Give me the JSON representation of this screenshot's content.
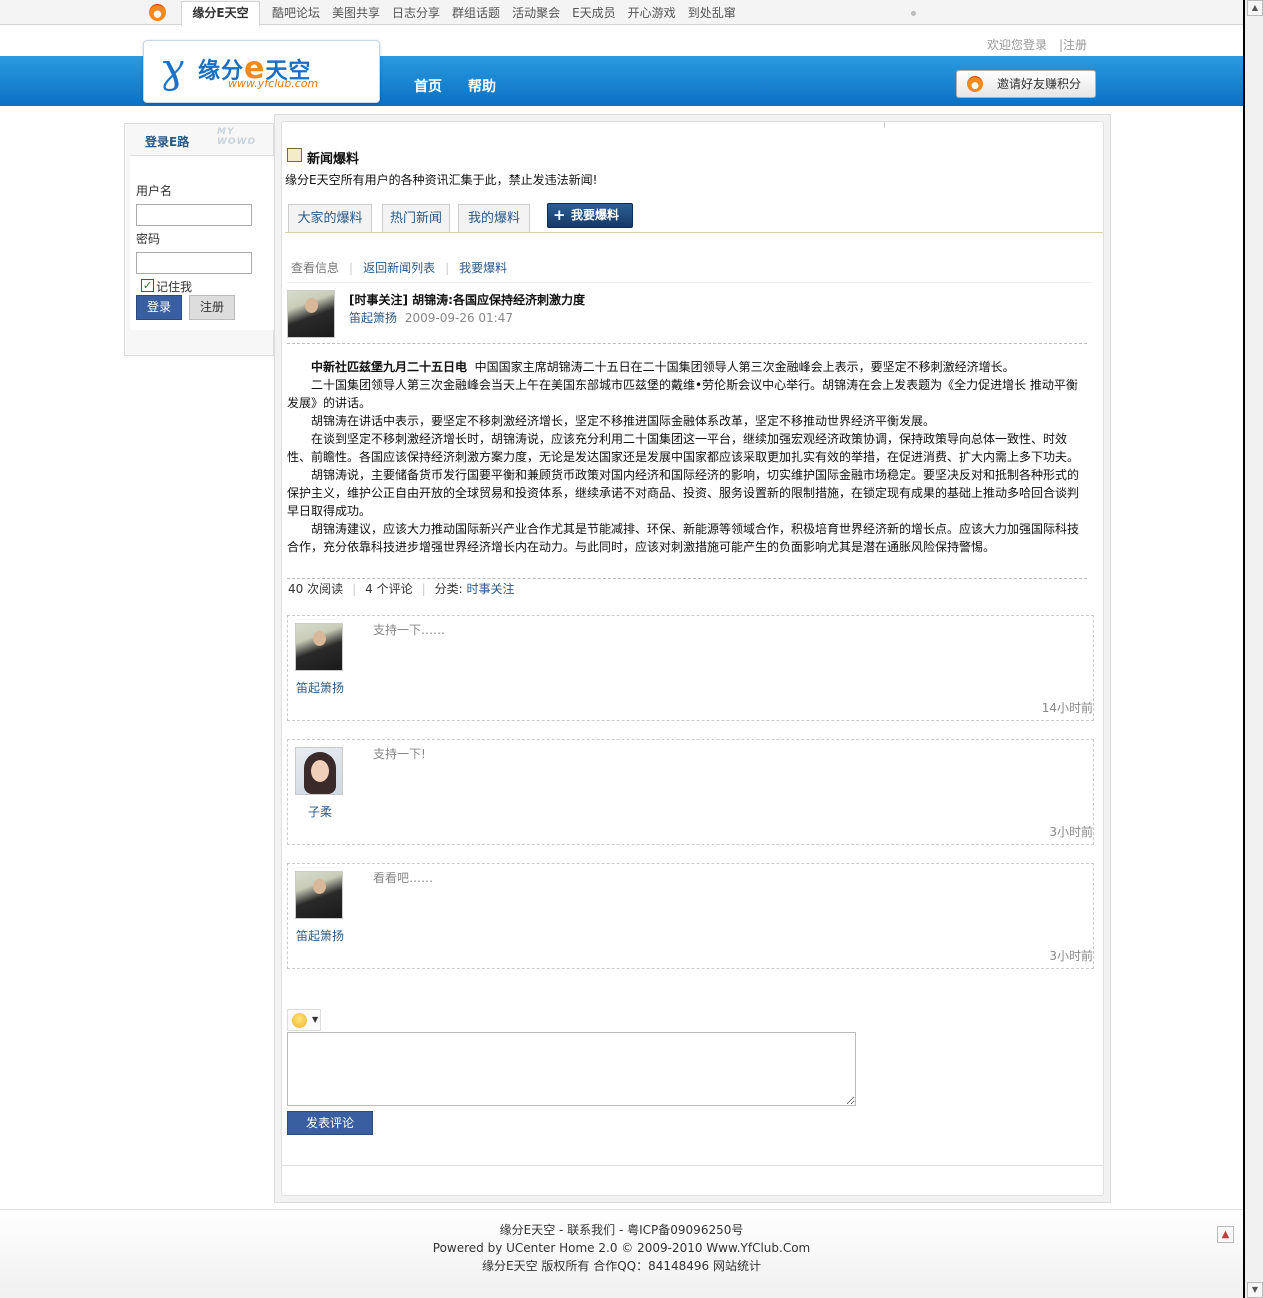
{
  "topbar": {
    "site_tab": "缘分E天空",
    "nav": [
      "酷吧论坛",
      "美图共享",
      "日志分享",
      "群组话题",
      "活动聚会",
      "E天成员",
      "开心游戏",
      "到处乱窜"
    ],
    "user_links": "欢迎您登录　|注册"
  },
  "header": {
    "logo_name": "缘分",
    "logo_e": "e",
    "logo_name2": "天空",
    "logo_url": "www.yfclub.com",
    "nav": [
      "首页",
      "帮助"
    ],
    "invite_label": "邀请好友赚积分"
  },
  "sidebar": {
    "title": "登录E路",
    "deco": "MY WOWO",
    "username_label": "用户名",
    "password_label": "密码",
    "remember_label": "记住我",
    "login_button": "登录",
    "register_button": "注册"
  },
  "page": {
    "title": "新闻爆料",
    "description": "缘分E天空所有用户的各种资讯汇集于此，禁止发违法新闻!",
    "tabs": [
      "大家的爆料",
      "热门新闻",
      "我的爆料"
    ],
    "post_button": "我要爆料",
    "subnav": [
      "查看信息",
      "返回新闻列表",
      "我要爆料"
    ]
  },
  "post": {
    "title": "[时事关注] 胡锦涛:各国应保持经济刺激力度",
    "author": "笛起箫扬",
    "date": "2009-09-26 01:47",
    "lead_bold": "中新社匹兹堡九月二十五日电",
    "paragraphs": [
      "中国国家主席胡锦涛二十五日在二十国集团领导人第三次金融峰会上表示，要坚定不移刺激经济增长。",
      "二十国集团领导人第三次金融峰会当天上午在美国东部城市匹兹堡的戴维•劳伦斯会议中心举行。胡锦涛在会上发表题为《全力促进增长 推动平衡发展》的讲话。",
      "胡锦涛在讲话中表示，要坚定不移刺激经济增长，坚定不移推进国际金融体系改革，坚定不移推动世界经济平衡发展。",
      "在谈到坚定不移刺激经济增长时，胡锦涛说，应该充分利用二十国集团这一平台，继续加强宏观经济政策协调，保持政策导向总体一致性、时效性、前瞻性。各国应该保持经济刺激方案力度，无论是发达国家还是发展中国家都应该采取更加扎实有效的举措，在促进消费、扩大内需上多下功夫。",
      "胡锦涛说，主要储备货币发行国要平衡和兼顾货币政策对国内经济和国际经济的影响，切实维护国际金融市场稳定。要坚决反对和抵制各种形式的保护主义，维护公正自由开放的全球贸易和投资体系，继续承诺不对商品、投资、服务设置新的限制措施，在锁定现有成果的基础上推动多哈回合谈判早日取得成功。",
      "胡锦涛建议，应该大力推动国际新兴产业合作尤其是节能减排、环保、新能源等领域合作，积极培育世界经济新的增长点。应该大力加强国际科技合作，充分依靠科技进步增强世界经济增长内在动力。与此同时，应该对刺激措施可能产生的负面影响尤其是潜在通胀风险保持警惕。"
    ],
    "views": "40 次阅读",
    "comments_count": "4 个评论",
    "category_label": "分类:",
    "category": "时事关注"
  },
  "comments": [
    {
      "name": "笛起箫扬",
      "text": "支持一下……",
      "time": "14小时前"
    },
    {
      "name": "子柔",
      "text": "支持一下!",
      "time": "3小时前"
    },
    {
      "name": "笛起箫扬",
      "text": "看看吧……",
      "time": "3小时前"
    }
  ],
  "comment_form": {
    "submit_button": "发表评论"
  },
  "footer": {
    "line1": "缘分E天空 - 联系我们 - 粤ICP备09096250号",
    "line2": "Powered by UCenter Home 2.0 © 2009-2010 Www.YfClub.Com",
    "line3": "缘分E天空 版权所有 合作QQ：84148496 网站统计"
  },
  "colors": {
    "header_blue": "#0b70c4",
    "link": "#2a5a8a",
    "button": "#3a5fa0"
  }
}
